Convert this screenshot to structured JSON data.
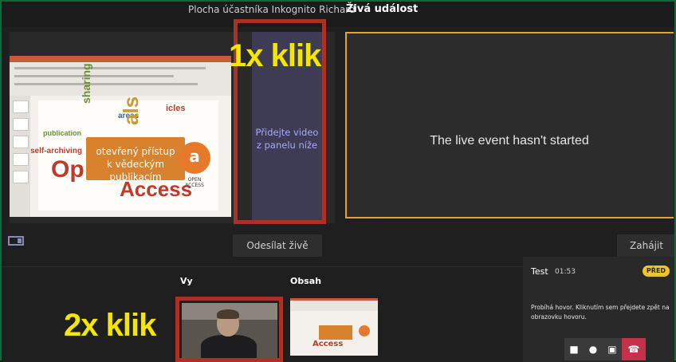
{
  "header": {
    "preview_title": "Plocha účastníka Inkognito Richard",
    "live_title": "Živá událost"
  },
  "stage": {
    "queue_text_line1": "Přidejte video",
    "queue_text_line2": "z panelu níže",
    "send_live_button": "Odesílat živě",
    "slide": {
      "callout_line1": "otevřený přístup",
      "callout_line2": "k vědeckým publikacím",
      "big_word": "Access",
      "big_word_prefix": "Op",
      "oa_label": "OPEN ACCESS"
    }
  },
  "live": {
    "message": "The live event hasn't started",
    "start_button": "Zahájit"
  },
  "annotations": {
    "first": "1x klik",
    "second": "2x klik"
  },
  "sources": {
    "you_label": "Vy",
    "content_label": "Obsah"
  },
  "call": {
    "title": "Test",
    "time": "01:53",
    "badge": "PŘED",
    "message": "Probíhá hovor. Kliknutím sem přejdete zpět na obrazovku hovoru."
  },
  "colors": {
    "live_border": "#e0a626",
    "annotation": "#f3e700",
    "highlight_box": "#a93225",
    "hangup": "#c4314b",
    "queue_slot": "#3d3c54"
  }
}
